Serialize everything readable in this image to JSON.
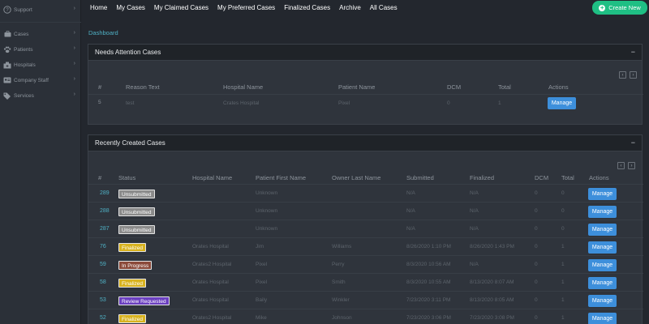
{
  "sidebar": {
    "items": [
      {
        "label": "Support",
        "icon": "question-circle-icon"
      },
      {
        "label": "Cases",
        "icon": "briefcase-icon"
      },
      {
        "label": "Patients",
        "icon": "paw-icon"
      },
      {
        "label": "Hospitals",
        "icon": "hospital-icon"
      },
      {
        "label": "Company Staff",
        "icon": "id-card-icon"
      },
      {
        "label": "Services",
        "icon": "tags-icon"
      }
    ]
  },
  "nav": {
    "links": [
      "Home",
      "My Cases",
      "My Claimed Cases",
      "My Preferred Cases",
      "Finalized Cases",
      "Archive",
      "All Cases"
    ],
    "create_label": "Create New"
  },
  "breadcrumb": "Dashboard",
  "attention": {
    "title": "Needs Attention Cases",
    "collapse": "−",
    "columns": [
      "#",
      "Reason Text",
      "Hospital Name",
      "Patient Name",
      "DCM",
      "Total",
      "Actions"
    ],
    "rows": [
      {
        "id": "5",
        "reason": "test",
        "hospital": "Crates Hospital",
        "patient": "Pixel",
        "dcm": "0",
        "total": "1",
        "action": "Manage"
      }
    ]
  },
  "recent": {
    "title": "Recently Created Cases",
    "collapse": "−",
    "columns": [
      "#",
      "Status",
      "Hospital Name",
      "Patient First Name",
      "Owner Last Name",
      "Submitted",
      "Finalized",
      "DCM",
      "Total",
      "Actions"
    ],
    "rows": [
      {
        "id": "289",
        "status": "Unsubmitted",
        "status_color": "#8a8a8a",
        "hospital": "",
        "patient": "Unknown",
        "owner": "",
        "submitted": "N/A",
        "finalized": "N/A",
        "dcm": "0",
        "total": "0",
        "action": "Manage"
      },
      {
        "id": "288",
        "status": "Unsubmitted",
        "status_color": "#8a8a8a",
        "hospital": "",
        "patient": "Unknown",
        "owner": "",
        "submitted": "N/A",
        "finalized": "N/A",
        "dcm": "0",
        "total": "0",
        "action": "Manage"
      },
      {
        "id": "287",
        "status": "Unsubmitted",
        "status_color": "#8a8a8a",
        "hospital": "",
        "patient": "Unknown",
        "owner": "",
        "submitted": "N/A",
        "finalized": "N/A",
        "dcm": "0",
        "total": "0",
        "action": "Manage"
      },
      {
        "id": "76",
        "status": "Finalized",
        "status_color": "#d8b21e",
        "hospital": "Orates Hospital",
        "patient": "Jim",
        "owner": "Williams",
        "submitted": "8/26/2020 1:10 PM",
        "finalized": "8/26/2020 1:43 PM",
        "dcm": "0",
        "total": "1",
        "action": "Manage"
      },
      {
        "id": "59",
        "status": "In Progress",
        "status_color": "#8b4a3a",
        "hospital": "Orates2 Hospital",
        "patient": "Pixel",
        "owner": "Perry",
        "submitted": "8/3/2020 10:56 AM",
        "finalized": "N/A",
        "dcm": "0",
        "total": "1",
        "action": "Manage"
      },
      {
        "id": "58",
        "status": "Finalized",
        "status_color": "#d8b21e",
        "hospital": "Orates Hospital",
        "patient": "Pixel",
        "owner": "Smith",
        "submitted": "8/3/2020 10:55 AM",
        "finalized": "8/13/2020 8:07 AM",
        "dcm": "0",
        "total": "1",
        "action": "Manage"
      },
      {
        "id": "53",
        "status": "Review Requested",
        "status_color": "#6a3fc0",
        "hospital": "Orates Hospital",
        "patient": "Baily",
        "owner": "Winkler",
        "submitted": "7/23/2020 3:11 PM",
        "finalized": "8/13/2020 8:05 AM",
        "dcm": "0",
        "total": "1",
        "action": "Manage"
      },
      {
        "id": "52",
        "status": "Finalized",
        "status_color": "#d8b21e",
        "hospital": "Orates2 Hospital",
        "patient": "Mike",
        "owner": "Johnson",
        "submitted": "7/23/2020 3:06 PM",
        "finalized": "7/23/2020 3:08 PM",
        "dcm": "0",
        "total": "1",
        "action": "Manage"
      }
    ]
  }
}
